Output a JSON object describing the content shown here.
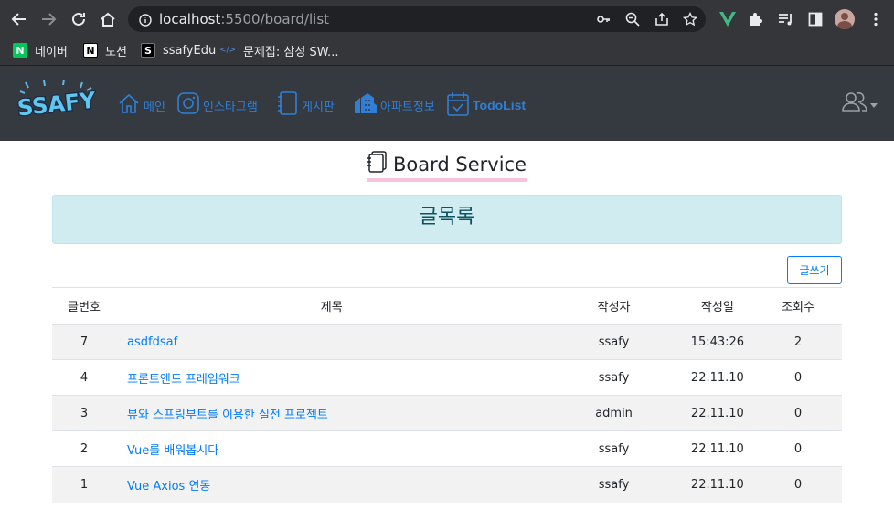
{
  "browser": {
    "url_host": "localhost",
    "url_path": ":5500/board/list",
    "bookmarks": [
      {
        "label": "네이버",
        "icon": "naver-icon",
        "fav_text": "N",
        "color": "#03c75a"
      },
      {
        "label": "노션",
        "icon": "notion-icon",
        "fav_text": "N",
        "color": "#ffffff"
      },
      {
        "label": "ssafyEdu",
        "icon": "ssafy-edu-icon",
        "fav_text": "S",
        "color": "#000000"
      },
      {
        "label": "문제집: 삼성 SW...",
        "icon": "code-icon",
        "fav_text": "</>",
        "color": "#4a8ad4"
      }
    ]
  },
  "nav": {
    "logo_text": "SSAFY",
    "items": [
      {
        "label": "메인",
        "icon": "home-icon"
      },
      {
        "label": "인스타그램",
        "icon": "instagram-icon"
      },
      {
        "label": "게시판",
        "icon": "notebook-icon"
      },
      {
        "label": "아파트정보",
        "icon": "buildings-icon"
      },
      {
        "label": "TodoList",
        "icon": "calendar-check-icon"
      }
    ],
    "user_icon": "people-icon"
  },
  "page": {
    "title": "Board Service",
    "banner": "글목록",
    "write_button": "글쓰기"
  },
  "table": {
    "headers": [
      "글번호",
      "제목",
      "작성자",
      "작성일",
      "조회수"
    ],
    "rows": [
      {
        "no": "7",
        "title": "asdfdsaf",
        "writer": "ssafy",
        "date": "15:43:26",
        "hits": "2"
      },
      {
        "no": "4",
        "title": "프론트엔드 프레임워크",
        "writer": "ssafy",
        "date": "22.11.10",
        "hits": "0"
      },
      {
        "no": "3",
        "title": "뷰와 스프링부트를 이용한 실전 프로젝트",
        "writer": "admin",
        "date": "22.11.10",
        "hits": "0"
      },
      {
        "no": "2",
        "title": "Vue를 배워봅시다",
        "writer": "ssafy",
        "date": "22.11.10",
        "hits": "0"
      },
      {
        "no": "1",
        "title": "Vue Axios 연동",
        "writer": "ssafy",
        "date": "22.11.10",
        "hits": "0"
      }
    ]
  },
  "colors": {
    "navbar": "#343a40",
    "link": "#007bff",
    "banner_bg": "#d1ecf1",
    "title_underline": "#f6c4dd"
  }
}
